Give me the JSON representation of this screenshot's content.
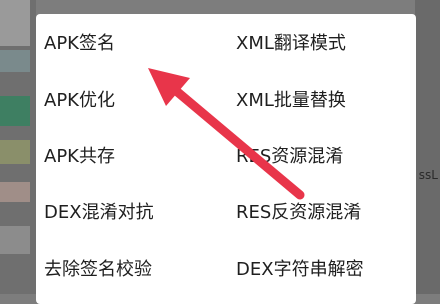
{
  "background": {
    "right_edge_text": "ssL"
  },
  "menu": {
    "items": [
      {
        "label": "APK签名"
      },
      {
        "label": "XML翻译模式"
      },
      {
        "label": "APK优化"
      },
      {
        "label": "XML批量替换"
      },
      {
        "label": "APK共存"
      },
      {
        "label": "RES资源混淆"
      },
      {
        "label": "DEX混淆对抗"
      },
      {
        "label": "RES反资源混淆"
      },
      {
        "label": "去除签名校验"
      },
      {
        "label": "DEX字符串解密"
      }
    ]
  },
  "annotation": {
    "arrow_color": "#e8354a",
    "icon": "red-pointer-arrow"
  }
}
